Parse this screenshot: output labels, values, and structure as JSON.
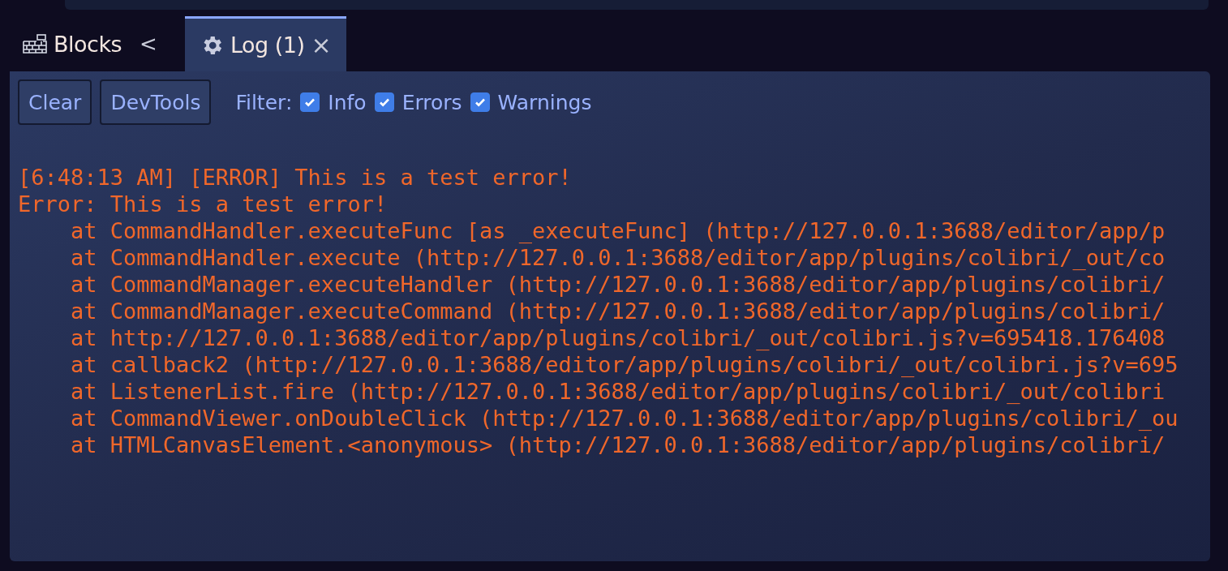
{
  "tabs": [
    {
      "label": "Blocks",
      "kind": "blocks",
      "selected": false,
      "action": "<"
    },
    {
      "label": "Log (1)",
      "kind": "gear",
      "selected": true,
      "action": "×"
    }
  ],
  "toolbar": {
    "buttons": [
      "Clear",
      "DevTools"
    ],
    "filter_label": "Filter:",
    "filters": [
      {
        "label": "Info",
        "checked": true
      },
      {
        "label": "Errors",
        "checked": true
      },
      {
        "label": "Warnings",
        "checked": true
      }
    ]
  },
  "log_lines": [
    "[6:48:13 AM] [ERROR] This is a test error!",
    "Error: This is a test error!",
    "    at CommandHandler.executeFunc [as _executeFunc] (http://127.0.0.1:3688/editor/app/p",
    "    at CommandHandler.execute (http://127.0.0.1:3688/editor/app/plugins/colibri/_out/co",
    "    at CommandManager.executeHandler (http://127.0.0.1:3688/editor/app/plugins/colibri/",
    "    at CommandManager.executeCommand (http://127.0.0.1:3688/editor/app/plugins/colibri/",
    "    at http://127.0.0.1:3688/editor/app/plugins/colibri/_out/colibri.js?v=695418.176408",
    "    at callback2 (http://127.0.0.1:3688/editor/app/plugins/colibri/_out/colibri.js?v=695",
    "    at ListenerList.fire (http://127.0.0.1:3688/editor/app/plugins/colibri/_out/colibri",
    "    at CommandViewer.onDoubleClick (http://127.0.0.1:3688/editor/app/plugins/colibri/_ou",
    "    at HTMLCanvasElement.<anonymous> (http://127.0.0.1:3688/editor/app/plugins/colibri/"
  ]
}
